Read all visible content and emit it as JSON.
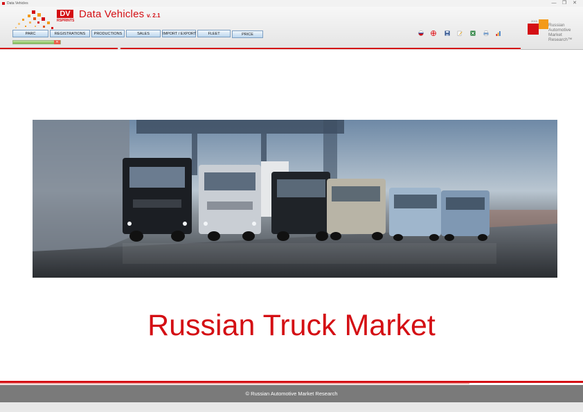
{
  "window": {
    "title": "Data Vehicles",
    "controls": [
      "minimize-icon",
      "restore-icon",
      "close-icon"
    ]
  },
  "app": {
    "badge_top": "DV",
    "badge_bottom": "RSPRINTS",
    "name": "Data Vehicles",
    "version": "v. 2.1"
  },
  "nav": {
    "tabs": [
      "PARC",
      "REGISTRATIONS",
      "PRODUCTIONS",
      "SALES",
      "IMPORT / EXPORT",
      "FLEET",
      "PRICE"
    ]
  },
  "progress": {
    "value": 1.0
  },
  "toolbar_icons": [
    "russian-flag-icon",
    "english-flag-icon",
    "save-icon",
    "edit-icon",
    "excel-icon",
    "print-icon",
    "chart-icon"
  ],
  "brand": {
    "small": "2015",
    "lines": [
      "Russian",
      "Automotive",
      "Market",
      "Research™"
    ]
  },
  "hero": {
    "alt": "trucks"
  },
  "main": {
    "title": "Russian Truck Market"
  },
  "footer": {
    "text": "© Russian Automotive Market Research"
  },
  "colors": {
    "accent": "#d40f14",
    "brand_orange": "#f39a1a",
    "footer_bg": "#7a7a7a"
  }
}
